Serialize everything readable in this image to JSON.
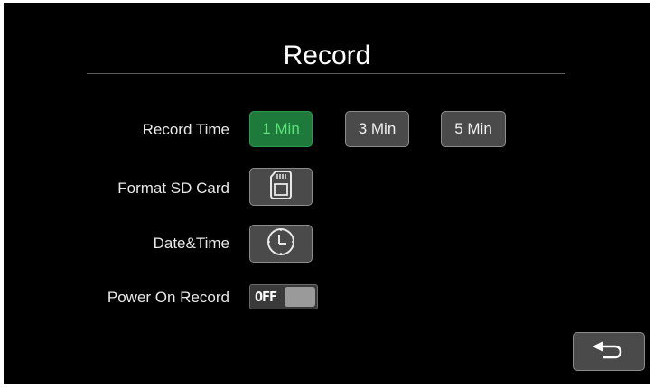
{
  "header": {
    "title": "Record"
  },
  "rows": {
    "record_time": {
      "label": "Record Time",
      "options": [
        "1 Min",
        "3 Min",
        "5 Min"
      ],
      "selected": "1 Min"
    },
    "format_sd": {
      "label": "Format SD Card",
      "icon": "sd-card-icon"
    },
    "date_time": {
      "label": "Date&Time",
      "icon": "clock-icon"
    },
    "power_on_record": {
      "label": "Power On Record",
      "state": "OFF"
    }
  },
  "back": {
    "icon": "back-arrow-icon"
  },
  "colors": {
    "selected_bg": "#1e7a3a",
    "selected_text": "#5de07a",
    "button_bg": "#4a4a4a",
    "background": "#000000"
  }
}
